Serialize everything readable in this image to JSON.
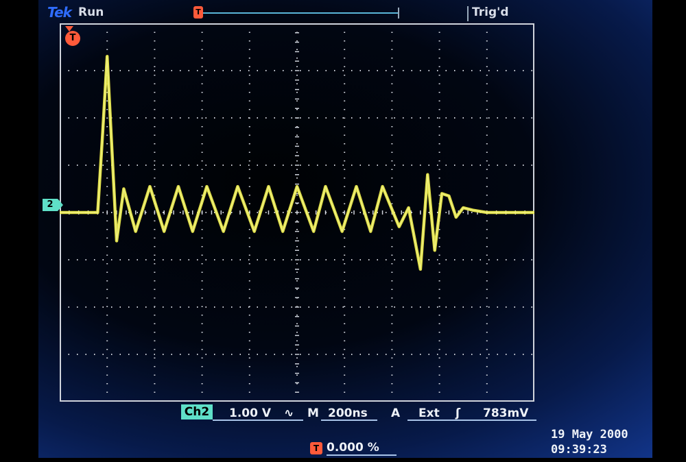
{
  "header": {
    "brand": "Tek",
    "acquisition_state": "Run",
    "trigger_state": "Trig'd",
    "record_marker": "T"
  },
  "markers": {
    "trigger_position": "T",
    "channel": "2"
  },
  "status_bar": {
    "channel": "Ch2",
    "volts_per_div": "1.00 V",
    "coupling_symbol": "∿",
    "timebase_prefix": "M",
    "time_per_div": "200ns",
    "trigger_mode": "A",
    "trigger_source": "Ext",
    "trigger_slope_symbol": "ʃ",
    "trigger_level": "783mV"
  },
  "trigger_position": {
    "marker": "T",
    "value": "0.000 %"
  },
  "timestamp": {
    "date": "19 May 2000",
    "time": "09:39:23"
  },
  "colors": {
    "trace": "#e8e84a",
    "graticule": "#d0d4dc",
    "ch2_marker": "#5fe0c8",
    "trigger_marker": "#ff5a3a",
    "brand": "#2f6cff"
  },
  "chart_data": {
    "type": "line",
    "xlim": [
      0,
      10
    ],
    "ylim": [
      -4,
      4
    ],
    "grid": true,
    "series": [
      {
        "x": [
          0,
          0.8,
          0.9,
          1.0,
          1.2,
          1.35,
          1.6,
          1.9,
          2.2,
          2.5,
          2.8,
          3.1,
          3.45,
          3.75,
          4.1,
          4.4,
          4.7,
          5.0,
          5.35,
          5.6,
          5.95,
          6.25,
          6.55,
          6.8,
          7.15,
          7.35,
          7.6,
          7.75,
          7.9,
          8.05,
          8.2,
          8.35,
          8.5,
          8.7,
          9.0,
          10.0
        ],
        "y": [
          0,
          0,
          1.6,
          3.3,
          -0.6,
          0.5,
          -0.4,
          0.55,
          -0.4,
          0.55,
          -0.4,
          0.55,
          -0.4,
          0.55,
          -0.4,
          0.55,
          -0.4,
          0.55,
          -0.4,
          0.55,
          -0.4,
          0.55,
          -0.4,
          0.55,
          -0.3,
          0.1,
          -1.2,
          0.8,
          -0.8,
          0.4,
          0.35,
          -0.1,
          0.1,
          0.05,
          0.0,
          0.0
        ]
      }
    ]
  }
}
